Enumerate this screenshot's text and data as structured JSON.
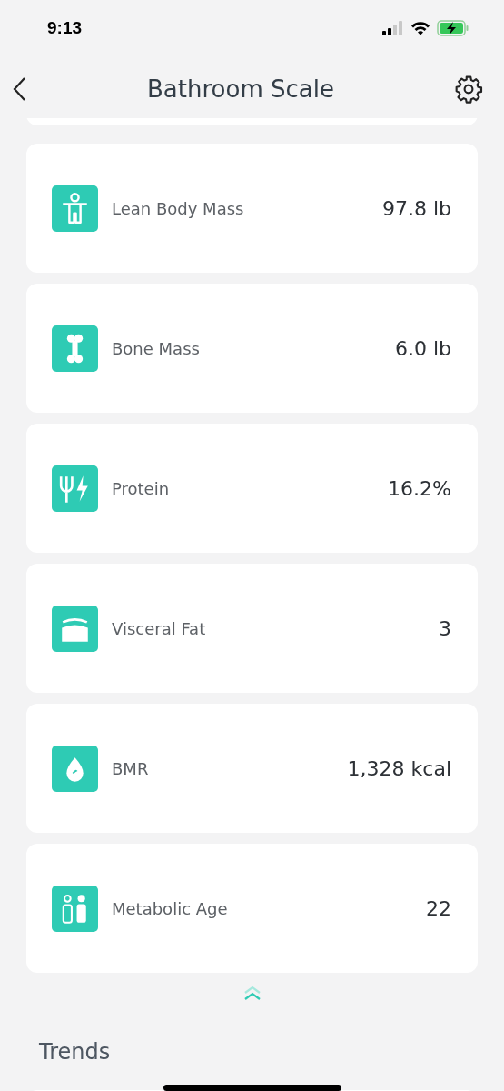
{
  "status_bar": {
    "time": "9:13"
  },
  "nav": {
    "title": "Bathroom Scale"
  },
  "metrics": [
    {
      "label": "Lean Body Mass",
      "value": "97.8 lb"
    },
    {
      "label": "Bone Mass",
      "value": "6.0 lb"
    },
    {
      "label": "Protein",
      "value": "16.2%"
    },
    {
      "label": "Visceral Fat",
      "value": "3"
    },
    {
      "label": "BMR",
      "value": "1,328 kcal"
    },
    {
      "label": "Metabolic Age",
      "value": "22"
    }
  ],
  "section": {
    "title": "Trends"
  }
}
